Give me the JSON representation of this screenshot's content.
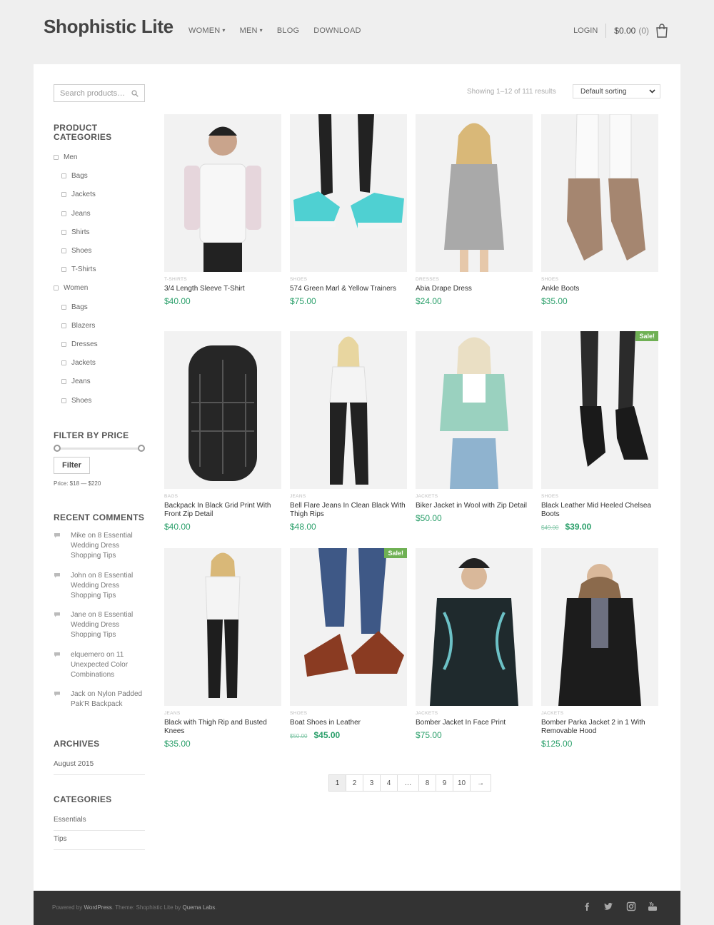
{
  "header": {
    "site_title": "Shophistic Lite",
    "nav": [
      {
        "label": "WOMEN",
        "dropdown": true
      },
      {
        "label": "MEN",
        "dropdown": true
      },
      {
        "label": "BLOG",
        "dropdown": false
      },
      {
        "label": "DOWNLOAD",
        "dropdown": false
      }
    ],
    "login_label": "LOGIN",
    "cart_total": "$0.00",
    "cart_count": "(0)"
  },
  "sidebar": {
    "search_placeholder": "Search products…",
    "categories_title": "PRODUCT CATEGORIES",
    "categories": [
      {
        "label": "Men",
        "level": 0
      },
      {
        "label": "Bags",
        "level": 1
      },
      {
        "label": "Jackets",
        "level": 1
      },
      {
        "label": "Jeans",
        "level": 1
      },
      {
        "label": "Shirts",
        "level": 1
      },
      {
        "label": "Shoes",
        "level": 1
      },
      {
        "label": "T-Shirts",
        "level": 1
      },
      {
        "label": "Women",
        "level": 0
      },
      {
        "label": "Bags",
        "level": 1
      },
      {
        "label": "Blazers",
        "level": 1
      },
      {
        "label": "Dresses",
        "level": 1
      },
      {
        "label": "Jackets",
        "level": 1
      },
      {
        "label": "Jeans",
        "level": 1
      },
      {
        "label": "Shoes",
        "level": 1
      }
    ],
    "filter_title": "FILTER BY PRICE",
    "filter_button": "Filter",
    "price_label": "Price: $18 — $220",
    "comments_title": "RECENT COMMENTS",
    "comments": [
      "Mike on 8 Essential Wedding Dress Shopping Tips",
      "John on 8 Essential Wedding Dress Shopping Tips",
      "Jane on 8 Essential Wedding Dress Shopping Tips",
      "elquemero on 11 Unexpected Color Combinations",
      "Jack on Nylon Padded Pak'R Backpack"
    ],
    "archives_title": "ARCHIVES",
    "archives": [
      "August 2015"
    ],
    "blog_categories_title": "CATEGORIES",
    "blog_categories": [
      "Essentials",
      "Tips"
    ]
  },
  "toolbar": {
    "result_count": "Showing 1–12 of 111 results",
    "sort_value": "Default sorting"
  },
  "products": [
    {
      "category": "T-SHIRTS",
      "title": "3/4 Length Sleeve T-Shirt",
      "price": "$40.00",
      "sale": false
    },
    {
      "category": "SHOES",
      "title": "574 Green Marl & Yellow Trainers",
      "price": "$75.00",
      "sale": false
    },
    {
      "category": "DRESSES",
      "title": "Abia Drape Dress",
      "price": "$24.00",
      "sale": false
    },
    {
      "category": "SHOES",
      "title": "Ankle Boots",
      "price": "$35.00",
      "sale": false
    },
    {
      "category": "BAGS",
      "title": "Backpack In Black Grid Print With Front Zip Detail",
      "price": "$40.00",
      "sale": false
    },
    {
      "category": "JEANS",
      "title": "Bell Flare Jeans In Clean Black With Thigh Rips",
      "price": "$48.00",
      "sale": false
    },
    {
      "category": "JACKETS",
      "title": "Biker Jacket in Wool with Zip Detail",
      "price": "$50.00",
      "sale": false
    },
    {
      "category": "SHOES",
      "title": "Black Leather Mid Heeled Chelsea Boots",
      "old_price": "$49.00",
      "price": "$39.00",
      "sale": true
    },
    {
      "category": "JEANS",
      "title": "Black with Thigh Rip and Busted Knees",
      "price": "$35.00",
      "sale": false
    },
    {
      "category": "SHOES",
      "title": "Boat Shoes in Leather",
      "old_price": "$50.00",
      "price": "$45.00",
      "sale": true
    },
    {
      "category": "JACKETS",
      "title": "Bomber Jacket In Face Print",
      "price": "$75.00",
      "sale": false
    },
    {
      "category": "JACKETS",
      "title": "Bomber Parka Jacket 2 in 1 With Removable Hood",
      "price": "$125.00",
      "sale": false
    }
  ],
  "sale_badge": "Sale!",
  "pagination": [
    "1",
    "2",
    "3",
    "4",
    "…",
    "8",
    "9",
    "10",
    "→"
  ],
  "footer": {
    "powered_by": "Powered by",
    "wordpress": "WordPress",
    "theme_text": ". Theme: Shophistic Lite by",
    "author": "Quema Labs",
    "end": "."
  },
  "colors": {
    "price": "#2a9f6a",
    "sale_badge": "#6fb054",
    "footer_bg": "#333333"
  }
}
